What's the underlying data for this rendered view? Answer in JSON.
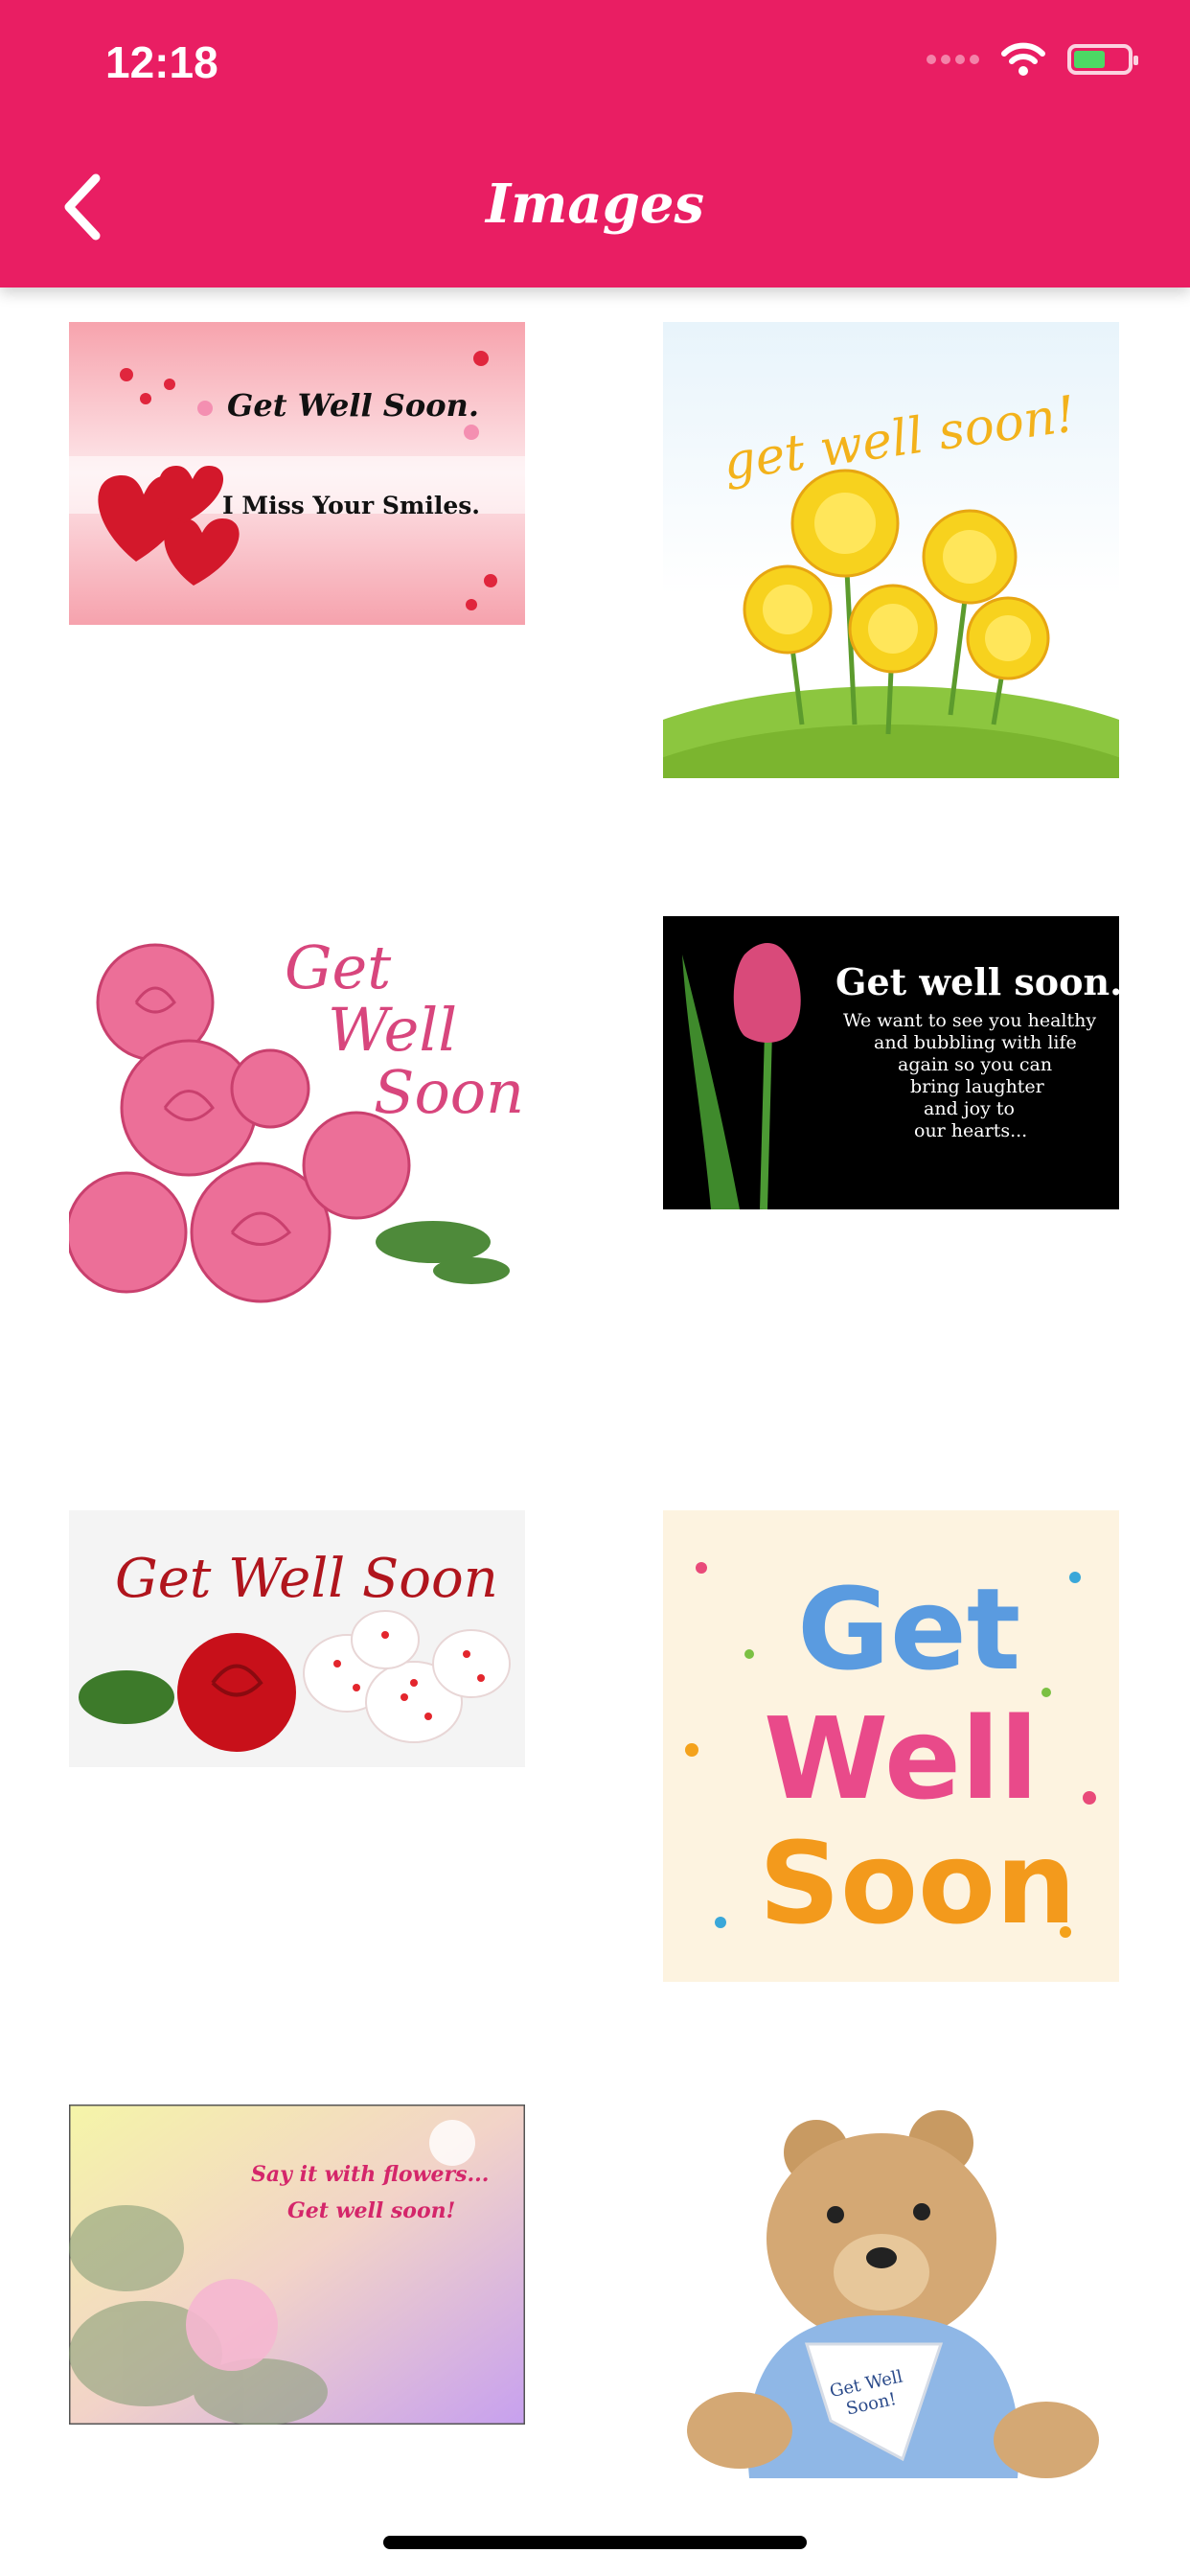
{
  "status_bar": {
    "time": "12:18"
  },
  "header": {
    "title": "Images",
    "back_icon": "chevron-left-icon"
  },
  "colors": {
    "accent": "#E91E63"
  },
  "images": [
    {
      "line1": "Get Well Soon.",
      "line2": "I Miss Your Smiles."
    },
    {
      "line1": "get well soon!"
    },
    {
      "line1": "Get",
      "line2": "Well",
      "line3": "Soon"
    },
    {
      "line1": "Get well soon.",
      "line2": "We want to see you healthy",
      "line3": "and bubbling with life",
      "line4": "again so you can",
      "line5": "bring laughter",
      "line6": "and joy to",
      "line7": "our hearts..."
    },
    {
      "line1": "Get Well Soon"
    },
    {
      "line1": "Get",
      "line2": "Well",
      "line3": "Soon"
    },
    {
      "line1": "Say it with flowers...",
      "line2": "Get well soon!"
    },
    {
      "line1": "Get Well",
      "line2": "Soon!"
    }
  ]
}
